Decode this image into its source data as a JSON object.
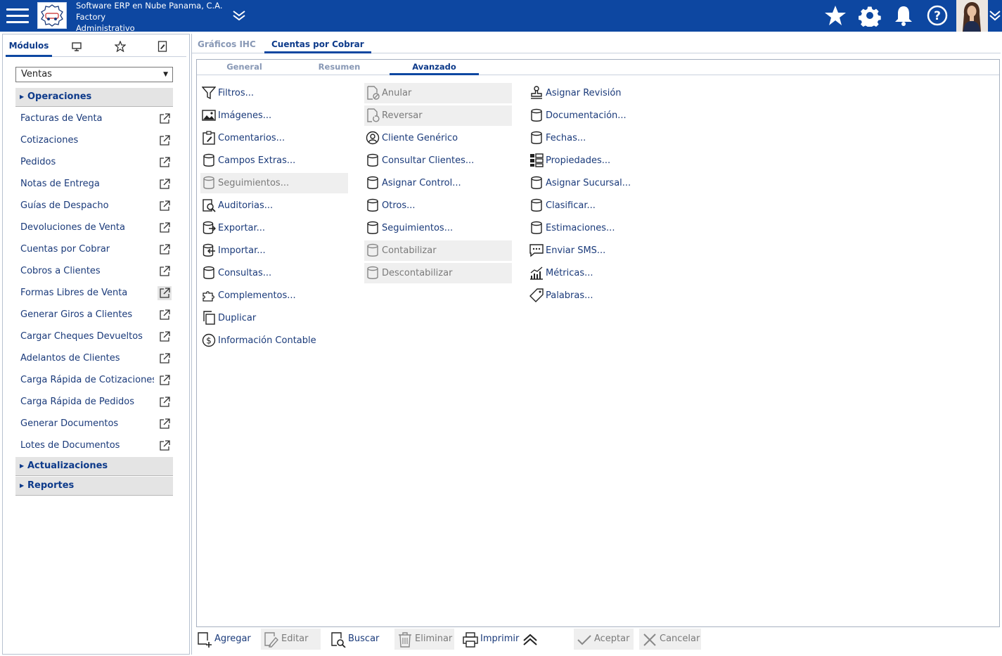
{
  "header": {
    "company_line1": "Software ERP en Nube Panama, C.A.",
    "company_line2": "Factory",
    "company_line3": "Administrativo",
    "bg_color": "#0d47a1",
    "icons": [
      "menu-icon",
      "star-icon",
      "gear-icon",
      "bell-icon",
      "help-icon",
      "chevron-down-icon"
    ]
  },
  "left": {
    "tabs": [
      {
        "label": "Módulos",
        "active": true
      },
      {
        "label": "",
        "icon": "monitor-icon"
      },
      {
        "label": "",
        "icon": "star-icon"
      },
      {
        "label": "",
        "icon": "document-edit-icon"
      }
    ],
    "module_select": "Ventas",
    "sections": {
      "operaciones": "Operaciones",
      "actualizaciones": "Actualizaciones",
      "reportes": "Reportes"
    },
    "items": [
      "Facturas de Venta",
      "Cotizaciones",
      "Pedidos",
      "Notas de Entrega",
      "Guías de Despacho",
      "Devoluciones de Venta",
      "Cuentas por Cobrar",
      "Cobros a Clientes",
      "Formas Libres de Venta",
      "Generar Giros a Clientes",
      "Cargar Cheques Devueltos",
      "Adelantos de Clientes",
      "Carga Rápida de Cotizaciones",
      "Carga Rápida de Pedidos",
      "Generar Documentos",
      "Lotes de Documentos"
    ]
  },
  "main": {
    "tabs": [
      "Gráficos IHC",
      "Cuentas por Cobrar"
    ],
    "active_tab": "Cuentas por Cobrar",
    "inner_tabs": [
      "General",
      "Resumen",
      "Avanzado"
    ],
    "active_inner_tab": "Avanzado",
    "col1": [
      {
        "label": "Filtros...",
        "icon": "filter-icon",
        "disabled": false
      },
      {
        "label": "Imágenes...",
        "icon": "image-icon",
        "disabled": false
      },
      {
        "label": "Comentarios...",
        "icon": "clipboard-edit-icon",
        "disabled": false
      },
      {
        "label": "Campos Extras...",
        "icon": "database-icon",
        "disabled": false
      },
      {
        "label": "Seguimientos...",
        "icon": "database-icon",
        "disabled": true
      },
      {
        "label": "Auditorias...",
        "icon": "audit-search-icon",
        "disabled": false
      },
      {
        "label": "Exportar...",
        "icon": "database-export-icon",
        "disabled": false
      },
      {
        "label": "Importar...",
        "icon": "database-import-icon",
        "disabled": false
      },
      {
        "label": "Consultas...",
        "icon": "database-icon",
        "disabled": false
      },
      {
        "label": "Complementos...",
        "icon": "puzzle-icon",
        "disabled": false
      },
      {
        "label": "Duplicar",
        "icon": "copy-icon",
        "disabled": false
      },
      {
        "label": "Información Contable",
        "icon": "dollar-circle-icon",
        "disabled": false
      }
    ],
    "col2": [
      {
        "label": "Anular",
        "icon": "document-cancel-icon",
        "disabled": true
      },
      {
        "label": "Reversar",
        "icon": "document-revert-icon",
        "disabled": true
      },
      {
        "label": "Cliente Genérico",
        "icon": "user-circle-icon",
        "disabled": false
      },
      {
        "label": "Consultar Clientes...",
        "icon": "database-icon",
        "disabled": false
      },
      {
        "label": "Asignar Control...",
        "icon": "database-icon",
        "disabled": false
      },
      {
        "label": "Otros...",
        "icon": "database-icon",
        "disabled": false
      },
      {
        "label": "Seguimientos...",
        "icon": "database-icon",
        "disabled": false
      },
      {
        "label": "Contabilizar",
        "icon": "database-icon",
        "disabled": true
      },
      {
        "label": "Descontabilizar",
        "icon": "database-icon",
        "disabled": true
      }
    ],
    "col3": [
      {
        "label": "Asignar Revisión",
        "icon": "stamp-icon",
        "disabled": false
      },
      {
        "label": "Documentación...",
        "icon": "database-icon",
        "disabled": false
      },
      {
        "label": "Fechas...",
        "icon": "database-icon",
        "disabled": false
      },
      {
        "label": "Propiedades...",
        "icon": "properties-grid-icon",
        "disabled": false
      },
      {
        "label": "Asignar Sucursal...",
        "icon": "database-icon",
        "disabled": false
      },
      {
        "label": "Clasificar...",
        "icon": "database-icon",
        "disabled": false
      },
      {
        "label": "Estimaciones...",
        "icon": "database-icon",
        "disabled": false
      },
      {
        "label": "Enviar SMS...",
        "icon": "sms-icon",
        "disabled": false
      },
      {
        "label": "Métricas...",
        "icon": "metrics-chart-icon",
        "disabled": false
      },
      {
        "label": "Palabras...",
        "icon": "tag-icon",
        "disabled": false
      }
    ]
  },
  "bottom": {
    "agregar": "Agregar",
    "editar": "Editar",
    "buscar": "Buscar",
    "eliminar": "Eliminar",
    "imprimir": "Imprimir",
    "aceptar": "Aceptar",
    "cancelar": "Cancelar"
  }
}
